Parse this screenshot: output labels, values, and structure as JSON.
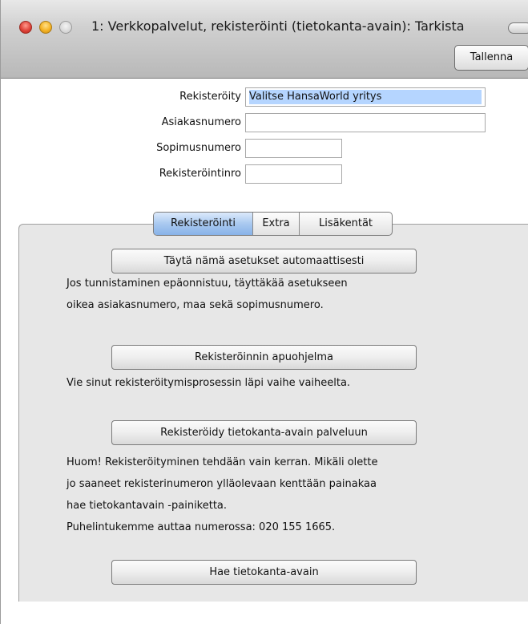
{
  "window": {
    "title": "1: Verkkopalvelut, rekisteröinti (tietokanta-avain): Tarkista",
    "save_label": "Tallenna"
  },
  "fields": {
    "registered_label": "Rekisteröity",
    "registered_value": "Valitse HansaWorld yritys",
    "customer_number_label": "Asiakasnumero",
    "customer_number_value": "",
    "contract_number_label": "Sopimusnumero",
    "contract_number_value": "",
    "registration_number_label": "Rekisteröintinro",
    "registration_number_value": ""
  },
  "tabs": [
    {
      "label": "Rekisteröinti",
      "active": true
    },
    {
      "label": "Extra",
      "active": false
    },
    {
      "label": "Lisäkentät",
      "active": false
    }
  ],
  "panel": {
    "autofill_button": "Täytä nämä asetukset automaattisesti",
    "autofill_text_1": "Jos tunnistaminen epäonnistuu, täyttäkää asetukseen",
    "autofill_text_2": "oikea asiakasnumero, maa sekä sopimusnumero.",
    "wizard_button": "Rekisteröinnin apuohjelma",
    "wizard_text": "Vie sinut rekisteröitymisprosessin läpi vaihe vaiheelta.",
    "register_button": "Rekisteröidy tietokanta-avain palveluun",
    "register_text_1": "Huom! Rekisteröityminen tehdään vain kerran. Mikäli olette",
    "register_text_2": "jo saaneet rekisterinumeron ylläolevaan kenttään painakaa",
    "register_text_3": "hae tietokantavain -painiketta.",
    "register_text_4": "Puhelintukemme auttaa numerossa: 020 155 1665.",
    "fetch_button": "Hae tietokanta-avain"
  }
}
